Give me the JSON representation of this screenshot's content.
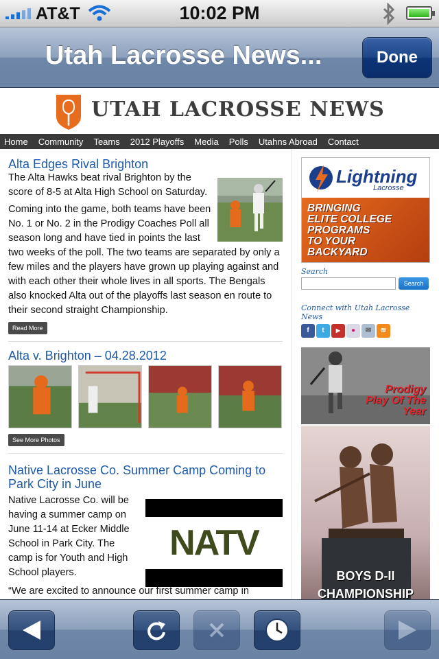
{
  "status_bar": {
    "carrier": "AT&T",
    "time": "10:02 PM",
    "signal_icon": "signal-bars-icon",
    "wifi_icon": "wifi-icon",
    "bluetooth_icon": "bluetooth-icon",
    "battery_icon": "battery-icon"
  },
  "nav_bar": {
    "title": "Utah Lacrosse News...",
    "done_label": "Done"
  },
  "site": {
    "name": "UTAH LACROSSE NEWS",
    "logo_icon": "lacrosse-shield-logo-icon",
    "menu": [
      "Home",
      "Community",
      "Teams",
      "2012 Playoffs",
      "Media",
      "Polls",
      "Utahns Abroad",
      "Contact"
    ]
  },
  "posts": [
    {
      "title": "Alta Edges Rival Brighton",
      "paragraphs": [
        "The Alta Hawks beat rival Brighton by the score of 8-5 at Alta High School on Saturday.",
        "Coming into the game, both teams have been No. 1 or No. 2 in the Prodigy Coaches Poll all season long and have tied in points the last two weeks of the poll. The two teams are separated by only a few miles and the players have grown up playing against and with each other their whole lives in all sports. The Bengals also knocked Alta out of the playoffs last season en route to their second straight Championship."
      ],
      "button": "Read More"
    },
    {
      "title": "Alta v. Brighton – 04.28.2012",
      "button": "See More Photos"
    },
    {
      "title": "Native Lacrosse Co. Summer Camp Coming to Park City in June",
      "paragraphs": [
        "Native Lacrosse Co. will be having a summer camp on June 11-14 at Ecker Middle School in Park City. The camp is for Youth and High School players.",
        "“We are excited to announce our first summer camp in"
      ],
      "image_text": "NATV"
    }
  ],
  "sidebar": {
    "ad": {
      "brand": "Lightning",
      "brand_sub": "Lacrosse",
      "tagline": [
        "BRINGING",
        "ELITE COLLEGE",
        "PROGRAMS",
        "TO YOUR",
        "BACKYARD"
      ]
    },
    "search_label": "Search",
    "search_button": "Search",
    "connect_label": "Connect with Utah Lacrosse News",
    "social_icons": [
      "facebook-icon",
      "twitter-icon",
      "youtube-icon",
      "flickr-icon",
      "email-icon",
      "rss-icon"
    ],
    "promo1": [
      "Prodigy",
      "Play Of The",
      "Year"
    ],
    "promo2": [
      "BOYS D-II",
      "CHAMPIONSHIP"
    ]
  },
  "toolbar": {
    "buttons": [
      "back-arrow-icon",
      "reload-icon",
      "stop-icon",
      "history-clock-icon",
      "forward-arrow-icon"
    ]
  },
  "colors": {
    "link_blue": "#1e5aa8",
    "ios_nav": "#6e86a8",
    "menu_bar": "#3a3a3a",
    "orange_accent": "#e86c1e"
  }
}
